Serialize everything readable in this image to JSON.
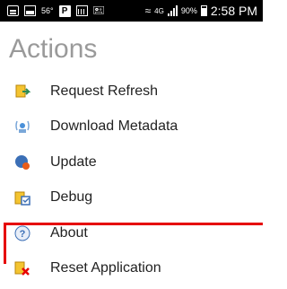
{
  "status_bar": {
    "network_label": "56°",
    "lte_label": "4G",
    "battery_percent": "90%",
    "time": "2:58 PM",
    "icons": [
      "message-icon",
      "image-icon",
      "p-icon",
      "calendar-icon",
      "voicemail-icon",
      "wifi-icon",
      "signal-icon",
      "battery-icon"
    ]
  },
  "page": {
    "title": "Actions"
  },
  "actions": [
    {
      "label": "Request Refresh",
      "icon": "refresh-document-icon"
    },
    {
      "label": "Download Metadata",
      "icon": "download-metadata-icon"
    },
    {
      "label": "Update",
      "icon": "update-icon"
    },
    {
      "label": "Debug",
      "icon": "debug-icon"
    },
    {
      "label": "About",
      "icon": "about-icon"
    },
    {
      "label": "Reset Application",
      "icon": "reset-icon"
    }
  ],
  "colors": {
    "highlight": "#e60000",
    "title": "#9a9a9a"
  }
}
